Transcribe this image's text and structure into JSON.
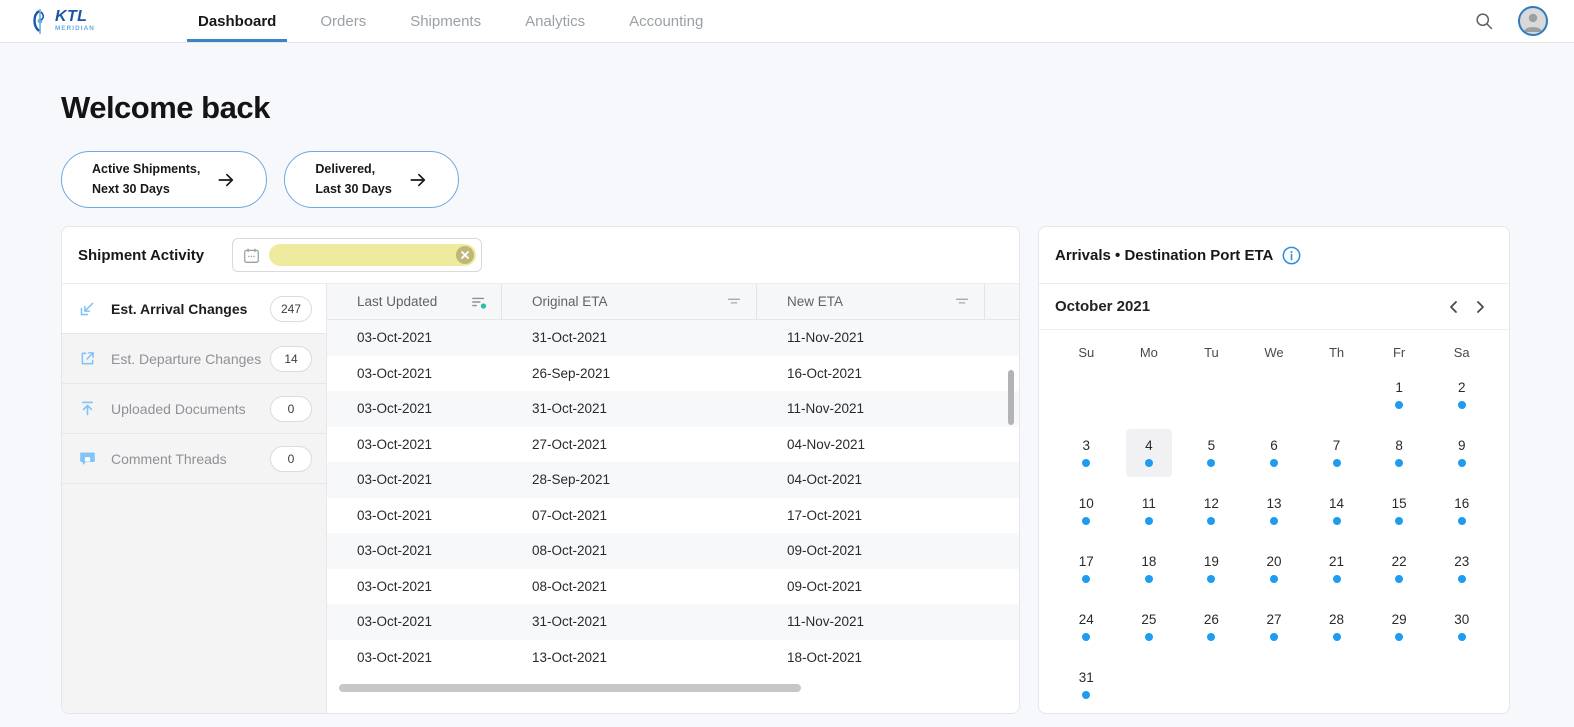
{
  "nav": {
    "logo": {
      "text": "KTL",
      "subtext": "MERIDIAN",
      "icon": "ktl-logo-mark"
    },
    "items": [
      {
        "label": "Dashboard",
        "active": true
      },
      {
        "label": "Orders",
        "active": false
      },
      {
        "label": "Shipments",
        "active": false
      },
      {
        "label": "Analytics",
        "active": false
      },
      {
        "label": "Accounting",
        "active": false
      }
    ],
    "right_icons": {
      "search": "search-icon",
      "avatar": "user-avatar-icon"
    },
    "active_color": "#3c85c5"
  },
  "page": {
    "title": "Welcome back"
  },
  "quick_links": [
    {
      "line1": "Active Shipments,",
      "line2": "Next 30 Days",
      "icon": "arrow-right-icon"
    },
    {
      "line1": "Delivered,",
      "line2": "Last 30 Days",
      "icon": "arrow-right-icon"
    }
  ],
  "shipment_activity": {
    "title": "Shipment Activity",
    "date_filter": {
      "value": "",
      "calendar_icon": "calendar-icon",
      "clear_icon": "clear-icon",
      "highlight_color": "#efeb9e"
    },
    "sidebar": [
      {
        "label": "Est. Arrival Changes",
        "count": "247",
        "icon": "arrival-changes-icon",
        "active": true
      },
      {
        "label": "Est. Departure Changes",
        "count": "14",
        "icon": "departure-changes-icon",
        "active": false
      },
      {
        "label": "Uploaded Documents",
        "count": "0",
        "icon": "upload-icon",
        "active": false
      },
      {
        "label": "Comment Threads",
        "count": "0",
        "icon": "comment-icon",
        "active": false
      }
    ],
    "table": {
      "columns": [
        {
          "label": "Last Updated",
          "filter_icon": "sort-icon",
          "filter_active": true
        },
        {
          "label": "Original ETA",
          "filter_icon": "filter-icon",
          "filter_active": false
        },
        {
          "label": "New ETA",
          "filter_icon": "filter-icon",
          "filter_active": false
        }
      ],
      "rows": [
        [
          "03-Oct-2021",
          "31-Oct-2021",
          "11-Nov-2021"
        ],
        [
          "03-Oct-2021",
          "26-Sep-2021",
          "16-Oct-2021"
        ],
        [
          "03-Oct-2021",
          "31-Oct-2021",
          "11-Nov-2021"
        ],
        [
          "03-Oct-2021",
          "27-Oct-2021",
          "04-Nov-2021"
        ],
        [
          "03-Oct-2021",
          "28-Sep-2021",
          "04-Oct-2021"
        ],
        [
          "03-Oct-2021",
          "07-Oct-2021",
          "17-Oct-2021"
        ],
        [
          "03-Oct-2021",
          "08-Oct-2021",
          "09-Oct-2021"
        ],
        [
          "03-Oct-2021",
          "08-Oct-2021",
          "09-Oct-2021"
        ],
        [
          "03-Oct-2021",
          "31-Oct-2021",
          "11-Nov-2021"
        ],
        [
          "03-Oct-2021",
          "13-Oct-2021",
          "18-Oct-2021"
        ]
      ],
      "filter_dot_color": "#2abfa3"
    }
  },
  "arrivals": {
    "title": "Arrivals • Destination Port ETA",
    "info_icon": "info-icon",
    "month_label": "October 2021",
    "prev_icon": "chevron-left-icon",
    "next_icon": "chevron-right-icon",
    "weekdays": [
      "Su",
      "Mo",
      "Tu",
      "We",
      "Th",
      "Fr",
      "Sa"
    ],
    "weeks": [
      [
        null,
        null,
        null,
        null,
        null,
        1,
        2
      ],
      [
        3,
        4,
        5,
        6,
        7,
        8,
        9
      ],
      [
        10,
        11,
        12,
        13,
        14,
        15,
        16
      ],
      [
        17,
        18,
        19,
        20,
        21,
        22,
        23
      ],
      [
        24,
        25,
        26,
        27,
        28,
        29,
        30
      ],
      [
        31,
        null,
        null,
        null,
        null,
        null,
        null
      ]
    ],
    "days_with_dot": [
      1,
      2,
      3,
      4,
      5,
      6,
      7,
      8,
      9,
      10,
      11,
      12,
      13,
      14,
      15,
      16,
      17,
      18,
      19,
      20,
      21,
      22,
      23,
      24,
      25,
      26,
      27,
      28,
      29,
      30,
      31
    ],
    "today": 4,
    "dot_color": "#1f9cf0"
  }
}
